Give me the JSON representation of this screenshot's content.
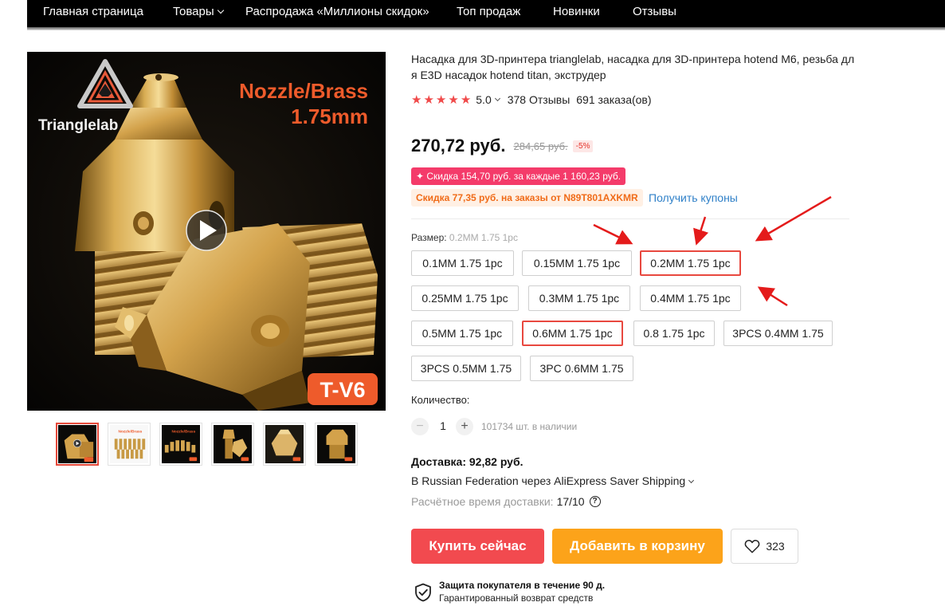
{
  "nav": {
    "items": [
      {
        "label": "Главная страница"
      },
      {
        "label": "Товары"
      },
      {
        "label": "Распродажа «Миллионы скидок»"
      },
      {
        "label": "Топ продаж"
      },
      {
        "label": "Новинки"
      },
      {
        "label": "Отзывы"
      }
    ]
  },
  "gallery": {
    "logo_text": "Trianglelab",
    "heading_line1": "Nozzle/Brass",
    "heading_line2": "1.75mm",
    "badge": "T-V6",
    "play_icon": "play-icon",
    "thumb_count": 6,
    "active_thumb": 1
  },
  "product": {
    "title": "Насадка для 3D-принтера trianglelab, насадка для 3D-принтера hotend M6, резьба для E3D насадок hotend titan, экструдер",
    "rating": "5.0",
    "reviews": "378 Отзывы",
    "orders": "691 заказа(ов)"
  },
  "price": {
    "current": "270,72 руб.",
    "old": "284,65 руб.",
    "discount": "-5%"
  },
  "promo": {
    "deal": "✦ Скидка 154,70 руб. за каждые 1 160,23 руб.",
    "coupon": "Скидка 77,35 руб. на заказы от N89T801AXKMR",
    "get_coupons": "Получить купоны"
  },
  "size": {
    "label": "Размер:",
    "selected": "0.2MM 1.75 1pc",
    "options": [
      "0.1MM 1.75 1pc",
      "0.15MM 1.75 1pc",
      "0.2MM 1.75 1pc",
      "0.25MM 1.75 1pc",
      "0.3MM 1.75 1pc",
      "0.4MM 1.75 1pc",
      "0.5MM 1.75 1pc",
      "0.6MM 1.75 1pc",
      "0.8 1.75 1pc",
      "3PCS 0.4MM 1.75",
      "3PCS 0.5MM 1.75",
      "3PC 0.6MM 1.75"
    ]
  },
  "quantity": {
    "label": "Количество:",
    "value": "1",
    "minus": "−",
    "plus": "+",
    "stock": "101734 шт. в наличии"
  },
  "shipping": {
    "title": "Доставка: 92,82 руб.",
    "method": "В Russian Federation через AliExpress Saver Shipping",
    "eta_label": "Расчётное время доставки:",
    "eta_value": "17/10",
    "help": "?"
  },
  "actions": {
    "buy": "Купить сейчас",
    "cart": "Добавить в корзину",
    "wishlist_count": "323"
  },
  "protection": {
    "title": "Защита покупателя в течение 90 д.",
    "subtitle": "Гарантированный возврат средств"
  },
  "colors": {
    "accent_red": "#f24a4f",
    "cart_orange": "#fca31a",
    "promo_pink": "#f43b6a",
    "annotation_red": "#e41b1b"
  }
}
